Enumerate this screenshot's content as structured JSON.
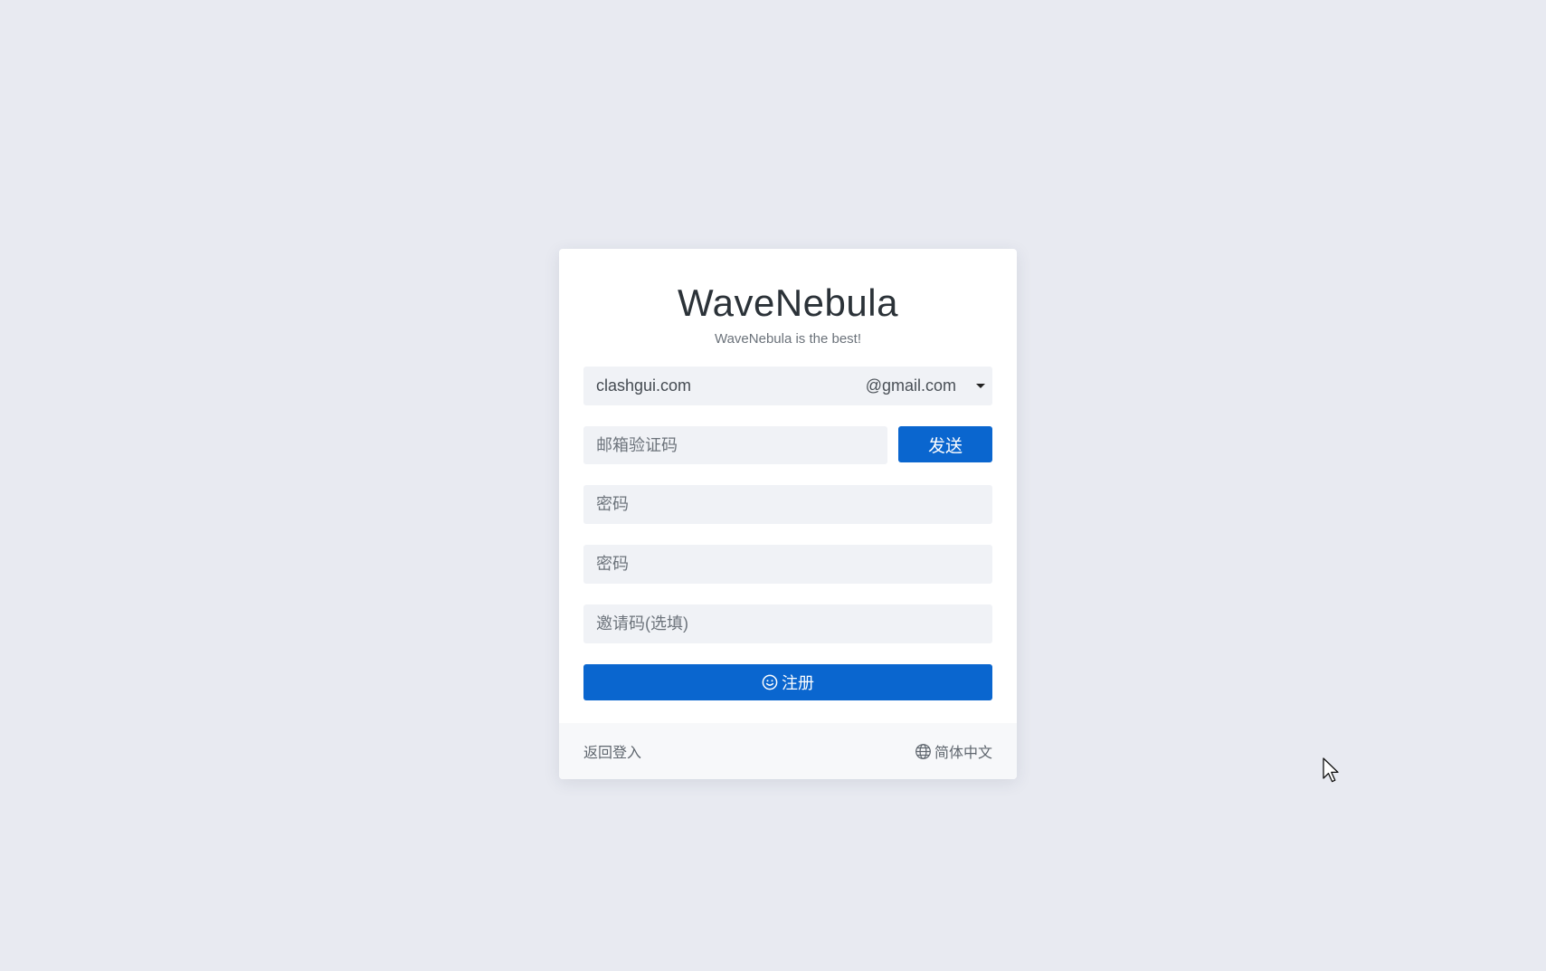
{
  "brand": {
    "title": "WaveNebula",
    "subtitle": "WaveNebula is the best!"
  },
  "form": {
    "email": {
      "value": "clashgui.com",
      "domain": "@gmail.com",
      "domain_icon": "caret-down-icon"
    },
    "code": {
      "placeholder": "邮箱验证码",
      "send_label": "发送"
    },
    "password": {
      "placeholder": "密码"
    },
    "password_confirm": {
      "placeholder": "密码"
    },
    "invite": {
      "placeholder": "邀请码(选填)"
    },
    "register": {
      "label": "注册",
      "icon": "smile-icon"
    }
  },
  "footer": {
    "back_label": "返回登入",
    "language_label": "简体中文",
    "language_icon": "globe-icon"
  },
  "colors": {
    "background": "#e8eaf1",
    "primary": "#0a66cf",
    "field": "#f0f2f6",
    "footer": "#f7f8fa"
  }
}
